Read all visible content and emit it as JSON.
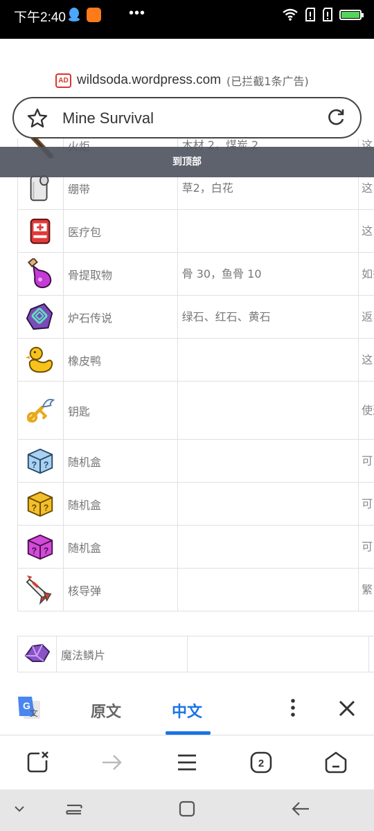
{
  "status": {
    "time": "下午2:40",
    "dots": "•••"
  },
  "browser": {
    "ad_badge": "AD",
    "domain": "wildsoda.wordpress.com",
    "blocked_text": "(已拦截1条广告)",
    "page_title": "Mine Survival"
  },
  "scroll_to_top": "到顶部",
  "table": {
    "rows": [
      {
        "icon": "torch-icon",
        "name": "火炬",
        "materials": "木材 2，煤炭 2",
        "note": "这"
      },
      {
        "icon": "bandage-icon",
        "name": "绷带",
        "materials": "草2，白花",
        "note": "这"
      },
      {
        "icon": "medkit-icon",
        "name": "医疗包",
        "materials": "",
        "note": "这"
      },
      {
        "icon": "potion-icon",
        "name": "骨提取物",
        "materials": "骨 30，鱼骨 10",
        "note": "如祭"
      },
      {
        "icon": "hearthstone-icon",
        "name": "炉石传说",
        "materials": "绿石、红石、黄石",
        "note": "返"
      },
      {
        "icon": "rubber-duck-icon",
        "name": "橡皮鸭",
        "materials": "",
        "note": "这"
      },
      {
        "icon": "winged-key-icon",
        "name": "钥匙",
        "materials": "",
        "note": "使这杀"
      },
      {
        "icon": "blue-mystery-box-icon",
        "name": "随机盒",
        "materials": "",
        "note": "可"
      },
      {
        "icon": "gold-mystery-box-icon",
        "name": "随机盒",
        "materials": "",
        "note": "可"
      },
      {
        "icon": "purple-mystery-box-icon",
        "name": "随机盒",
        "materials": "",
        "note": "可"
      },
      {
        "icon": "nuke-icon",
        "name": "核导弹",
        "materials": "",
        "note": "繁"
      }
    ],
    "second_table_row": {
      "icon": "magic-scale-icon",
      "name": "魔法鳞片",
      "materials": "",
      "note": ""
    }
  },
  "translate_bar": {
    "original_tab": "原文",
    "chinese_tab": "中文",
    "g_letter": "G",
    "wen": "文"
  },
  "toolbar": {
    "tab_count": "2"
  },
  "colors": {
    "accent": "#1a73e8",
    "ad_red": "#d9352b",
    "overlay": "#50555f"
  }
}
